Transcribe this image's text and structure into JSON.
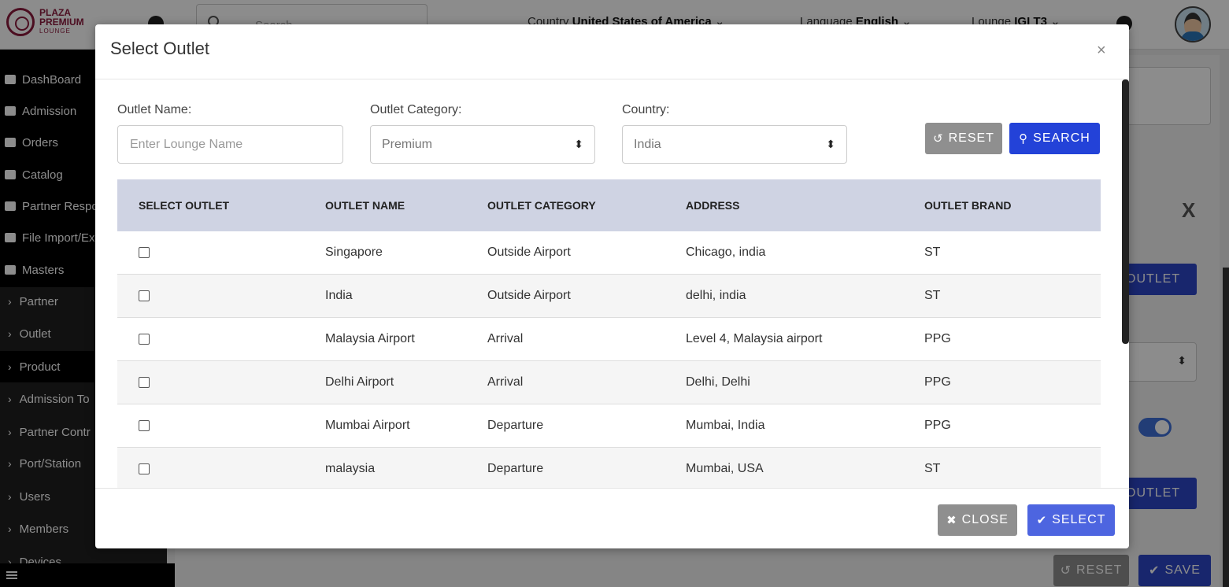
{
  "header": {
    "logo_line1": "PLAZA",
    "logo_line2": "PREMIUM",
    "logo_line3": "LOUNGE",
    "search_placeholder": "Search",
    "country_label": "Country",
    "country_value": "United States of America",
    "language_label": "Language",
    "language_value": "English",
    "lounge_label": "Lounge",
    "lounge_value": "IGI T3"
  },
  "sidebar": {
    "items": [
      {
        "label": "DashBoard",
        "icon": "dashboard-icon"
      },
      {
        "label": "Admission",
        "icon": "id-card-icon"
      },
      {
        "label": "Orders",
        "icon": "cart-icon"
      },
      {
        "label": "Catalog",
        "icon": "file-icon"
      },
      {
        "label": "Partner Respo",
        "icon": "reply-icon"
      },
      {
        "label": "File Import/Ex",
        "icon": "download-icon"
      },
      {
        "label": "Masters",
        "icon": "sitemap-icon"
      },
      {
        "label": "Partner"
      },
      {
        "label": "Outlet"
      },
      {
        "label": "Product"
      },
      {
        "label": "Admission To"
      },
      {
        "label": "Partner Contr"
      },
      {
        "label": "Port/Station"
      },
      {
        "label": "Users"
      },
      {
        "label": "Members"
      },
      {
        "label": "Devices"
      }
    ]
  },
  "background": {
    "add_outlet_label": "OUTLET",
    "add_outlet_label_2": "OUTLET",
    "close_x": "X",
    "reset_label": "RESET",
    "save_label": "SAVE"
  },
  "modal": {
    "title": "Select Outlet",
    "close_symbol": "×",
    "filters": {
      "outlet_name_label": "Outlet Name:",
      "outlet_name_placeholder": "Enter Lounge Name",
      "category_label": "Outlet Category:",
      "category_value": "Premium",
      "country_label": "Country:",
      "country_value": "India",
      "reset_label": "RESET",
      "search_label": "SEARCH"
    },
    "table": {
      "columns": [
        "SELECT OUTLET",
        "OUTLET NAME",
        "OUTLET CATEGORY",
        "ADDRESS",
        "OUTLET BRAND"
      ],
      "rows": [
        {
          "name": "Singapore",
          "category": "Outside Airport",
          "address": "Chicago, india",
          "brand": "ST"
        },
        {
          "name": "India",
          "category": "Outside Airport",
          "address": "delhi, india",
          "brand": "ST"
        },
        {
          "name": "Malaysia Airport",
          "category": "Arrival",
          "address": "Level 4, Malaysia airport",
          "brand": "PPG"
        },
        {
          "name": "Delhi Airport",
          "category": "Arrival",
          "address": "Delhi, Delhi",
          "brand": "PPG"
        },
        {
          "name": "Mumbai Airport",
          "category": "Departure",
          "address": "Mumbai, India",
          "brand": "PPG"
        },
        {
          "name": "malaysia",
          "category": "Departure",
          "address": "Mumbai, USA",
          "brand": "ST"
        }
      ]
    },
    "footer": {
      "close_label": "CLOSE",
      "select_label": "SELECT"
    }
  },
  "colors": {
    "primary": "#2342d8",
    "select_button": "#4d65e0",
    "gray_button": "#8f8f8f",
    "table_header": "#cfd3e3",
    "brand": "#8b1a3d"
  }
}
